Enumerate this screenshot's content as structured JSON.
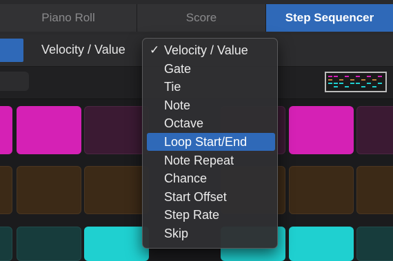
{
  "tabs": [
    {
      "label": "Piano Roll"
    },
    {
      "label": "Score"
    },
    {
      "label": "Step Sequencer"
    }
  ],
  "subbar": {
    "mode_label": "Velocity / Value"
  },
  "menu": {
    "checked_index": 0,
    "highlighted_index": 5,
    "items": [
      {
        "label": "Velocity / Value",
        "check": "✓"
      },
      {
        "label": "Gate"
      },
      {
        "label": "Tie"
      },
      {
        "label": "Note"
      },
      {
        "label": "Octave"
      },
      {
        "label": "Loop Start/End"
      },
      {
        "label": "Note Repeat"
      },
      {
        "label": "Chance"
      },
      {
        "label": "Start Offset"
      },
      {
        "label": "Step Rate"
      },
      {
        "label": "Skip"
      }
    ]
  },
  "colors": {
    "accent": "#2f69b8",
    "magenta": "#d521b5",
    "cyan": "#1fd0d0",
    "brown": "#3c2a17"
  }
}
